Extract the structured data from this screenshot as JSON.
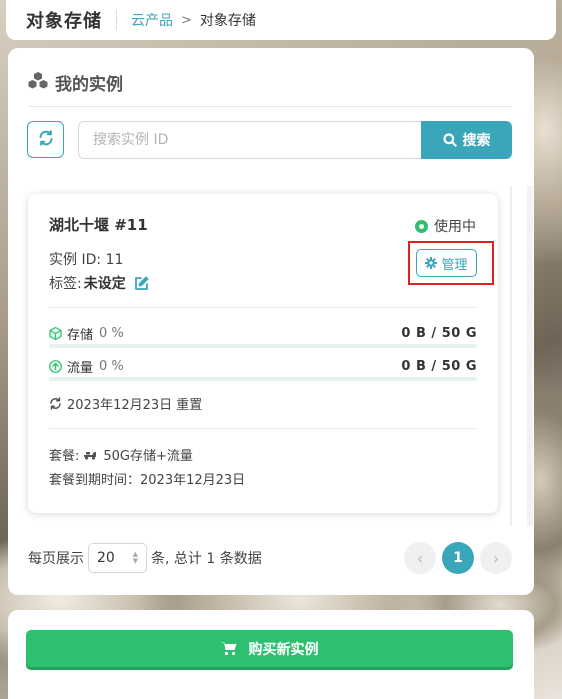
{
  "header": {
    "title": "对象存储",
    "breadcrumb": {
      "parent": "云产品",
      "separator": ">",
      "current": "对象存储"
    }
  },
  "panel": {
    "title": "我的实例",
    "title_icon": "cubes-icon"
  },
  "search": {
    "placeholder": "搜索实例 ID",
    "value": "",
    "button_label": "搜索",
    "refresh_icon": "refresh-icon"
  },
  "instance": {
    "name": "湖北十堰 #11",
    "status": "使用中",
    "id_label": "实例 ID:",
    "id_value": "11",
    "tag_label": "标签:",
    "tag_value": "未设定",
    "manage_label": "管理",
    "storage": {
      "label": "存储",
      "percent": "0 %",
      "usage": "0 B / 50 G",
      "fill": 0
    },
    "traffic": {
      "label": "流量",
      "percent": "0 %",
      "usage": "0 B / 50 G",
      "fill": 0
    },
    "reset": "2023年12月23日 重置",
    "plan_label": "套餐:",
    "plan_value": "50G存储+流量",
    "expire": "套餐到期时间：2023年12月23日"
  },
  "pagination": {
    "per_page_label": "每页展示",
    "page_size": "20",
    "summary": "条, 总计 1 条数据",
    "prev": "‹",
    "current_page": "1",
    "next": "›"
  },
  "buy": {
    "label": "购买新实例",
    "icon": "cart-icon"
  },
  "colors": {
    "accent": "#3aa6b9",
    "success": "#2fbf71",
    "highlight": "#e02020"
  }
}
